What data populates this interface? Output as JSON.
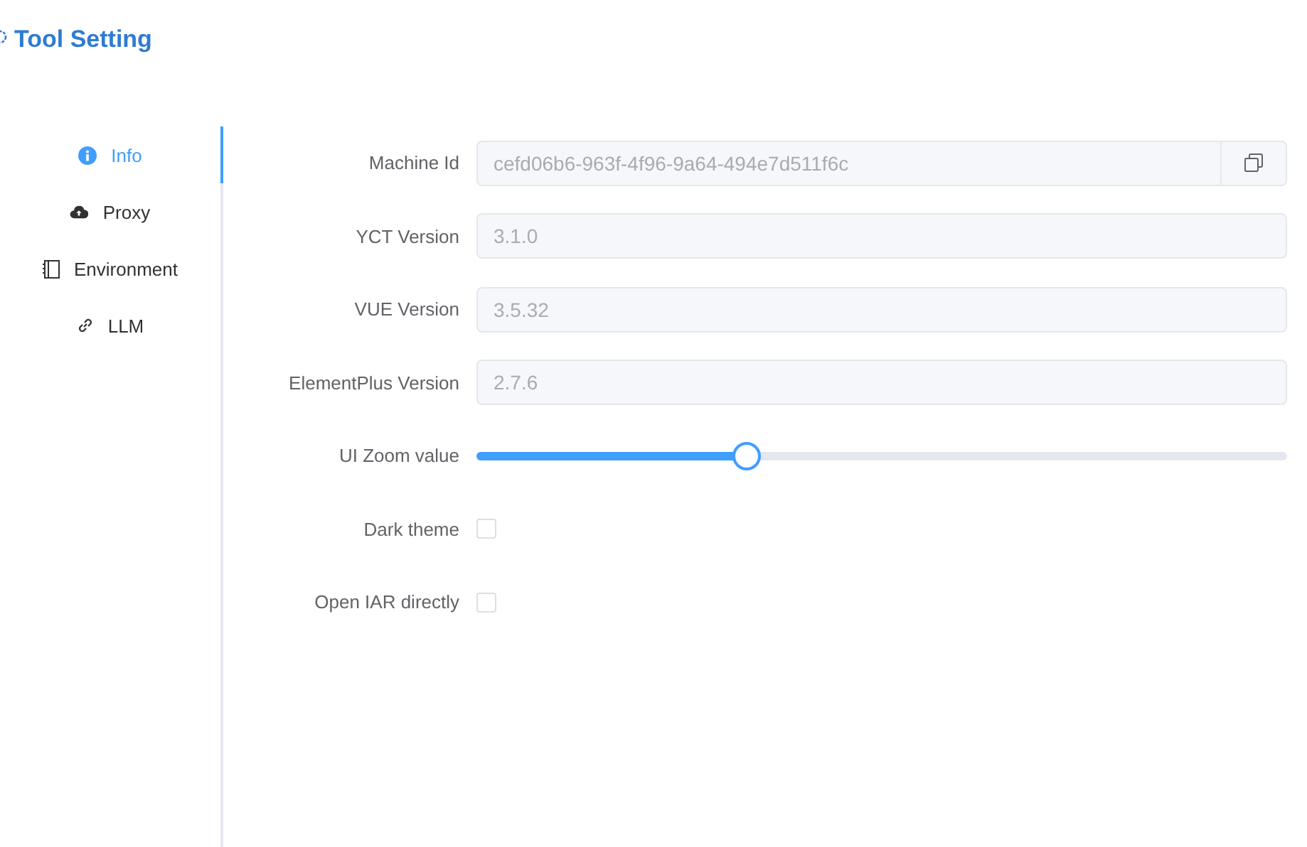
{
  "window": {
    "title": "Tool Setting"
  },
  "sidebar": {
    "items": [
      {
        "label": "Info",
        "selected": true
      },
      {
        "label": "Proxy",
        "selected": false
      },
      {
        "label": "Environment",
        "selected": false
      },
      {
        "label": "LLM",
        "selected": false
      }
    ]
  },
  "form": {
    "rows": [
      {
        "kind": "copy-input",
        "label": "Machine Id",
        "value": "cefd06b6-963f-4f96-9a64-494e7d511f6c"
      },
      {
        "kind": "input",
        "label": "YCT Version",
        "value": "3.1.0"
      },
      {
        "kind": "input",
        "label": "VUE Version",
        "value": "3.5.32"
      },
      {
        "kind": "input",
        "label": "ElementPlus Version",
        "value": "2.7.6"
      },
      {
        "kind": "slider",
        "label": "UI Zoom value",
        "level": 0.333
      },
      {
        "kind": "checkbox",
        "label": "Dark theme",
        "checked": false
      },
      {
        "kind": "checkbox",
        "label": "Open IAR directly",
        "checked": false
      }
    ]
  }
}
